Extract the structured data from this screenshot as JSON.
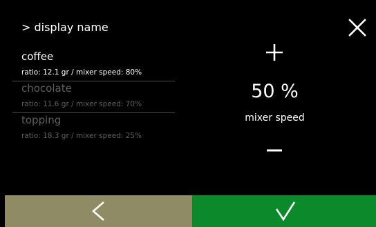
{
  "header": {
    "title": "> display name"
  },
  "recipes": [
    {
      "name": "coffee",
      "details": "ratio: 12.1 gr / mixer speed: 80%",
      "state": "selected"
    },
    {
      "name": "chocolate",
      "details": "ratio: 11.6 gr / mixer speed: 70%",
      "state": "unselected"
    },
    {
      "name": "topping",
      "details": "ratio: 18.3 gr / mixer speed: 25%",
      "state": "unselected"
    }
  ],
  "setting": {
    "value": "50 %",
    "label": "mixer speed"
  },
  "icons": {
    "close": "close-icon",
    "increase": "plus-icon",
    "decrease": "minus-icon",
    "back": "chevron-left-icon",
    "confirm": "check-icon"
  },
  "colors": {
    "background": "#000000",
    "text_active": "#ffffff",
    "text_inactive": "#5f5f5f",
    "back_button": "#8f8b64",
    "confirm_button": "#0c8a2b"
  }
}
